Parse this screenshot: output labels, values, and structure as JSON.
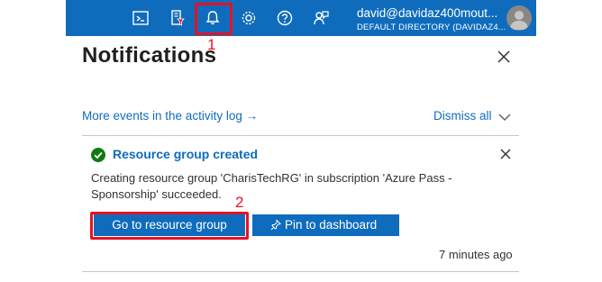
{
  "topbar": {
    "icons": [
      "cloud-shell-icon",
      "directory-filter-icon",
      "notifications-bell-icon",
      "settings-gear-icon",
      "help-question-icon",
      "feedback-icon"
    ],
    "user_email": "david@davidaz400mout...",
    "user_directory": "DEFAULT DIRECTORY (DAVIDAZ4..."
  },
  "panel": {
    "title": "Notifications",
    "activity_link": "More events in the activity log →",
    "dismiss_all": "Dismiss all"
  },
  "notification": {
    "title": "Resource group created",
    "message": "Creating resource group 'CharisTechRG' in subscription 'Azure Pass - Sponsorship' succeeded.",
    "primary_button": "Go to resource group",
    "secondary_button": "Pin to dashboard",
    "time": "7 minutes ago"
  },
  "annotations": [
    "1",
    "2"
  ],
  "colors": {
    "topbar": "#0f6cbd",
    "accent": "#0f6cbd",
    "success": "#107c10",
    "annotation": "#e81123"
  }
}
